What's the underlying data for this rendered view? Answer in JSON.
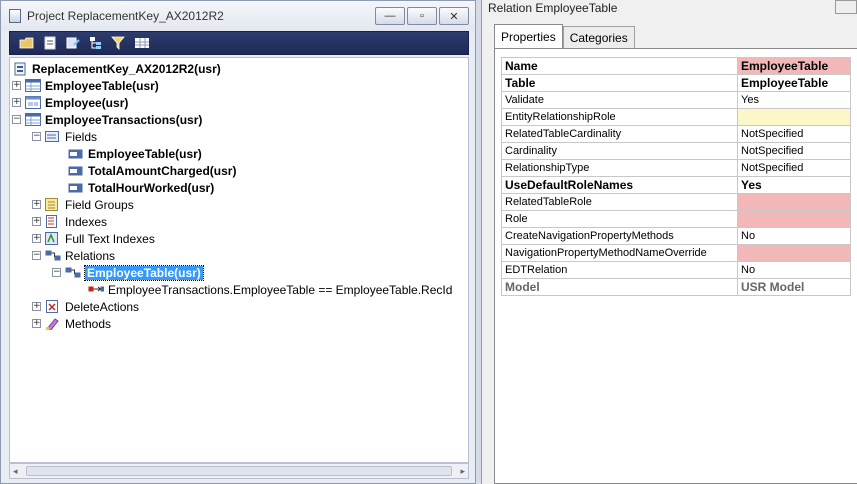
{
  "project_window": {
    "title": "Project ReplacementKey_AX2012R2",
    "buttons": {
      "minimize": "—",
      "restore": "▫",
      "close": "✕"
    },
    "toolbar_icons": [
      "open-folder-icon",
      "properties-icon",
      "compile-icon",
      "tree-icon",
      "filter-icon",
      "grid-icon"
    ],
    "tree": {
      "root": "ReplacementKey_AX2012R2(usr)",
      "employee_table": "EmployeeTable(usr)",
      "employee": "Employee(usr)",
      "employee_transactions": "EmployeeTransactions(usr)",
      "fields": "Fields",
      "field_employee_table": "EmployeeTable(usr)",
      "field_total_amount": "TotalAmountCharged(usr)",
      "field_total_hours": "TotalHourWorked(usr)",
      "field_groups": "Field Groups",
      "indexes": "Indexes",
      "full_text_indexes": "Full Text Indexes",
      "relations": "Relations",
      "relation_employee_table": "EmployeeTable(usr)",
      "relation_condition": "EmployeeTransactions.EmployeeTable == EmployeeTable.RecId",
      "delete_actions": "DeleteActions",
      "methods": "Methods"
    },
    "expanders": {
      "plus": "+",
      "minus": "−"
    },
    "scroll": {
      "left": "◂",
      "right": "▸"
    }
  },
  "properties_window": {
    "title": "Relation EmployeeTable",
    "tabs": [
      "Properties",
      "Categories"
    ],
    "rows": [
      {
        "name": "Name",
        "value": "EmployeeTable"
      },
      {
        "name": "Table",
        "value": "EmployeeTable"
      },
      {
        "name": "Validate",
        "value": "Yes"
      },
      {
        "name": "EntityRelationshipRole",
        "value": ""
      },
      {
        "name": "RelatedTableCardinality",
        "value": "NotSpecified"
      },
      {
        "name": "Cardinality",
        "value": "NotSpecified"
      },
      {
        "name": "RelationshipType",
        "value": "NotSpecified"
      },
      {
        "name": "UseDefaultRoleNames",
        "value": "Yes"
      },
      {
        "name": "RelatedTableRole",
        "value": ""
      },
      {
        "name": "Role",
        "value": ""
      },
      {
        "name": "CreateNavigationPropertyMethods",
        "value": "No"
      },
      {
        "name": "NavigationPropertyMethodNameOverride",
        "value": ""
      },
      {
        "name": "EDTRelation",
        "value": "No"
      },
      {
        "name": "Model",
        "value": "USR Model"
      }
    ]
  },
  "colors": {
    "selection": "#3399ff",
    "mandatory_field": "#f2b8b8",
    "edited_field": "#fbf7c9",
    "toolbar": "#2d3c6e"
  }
}
